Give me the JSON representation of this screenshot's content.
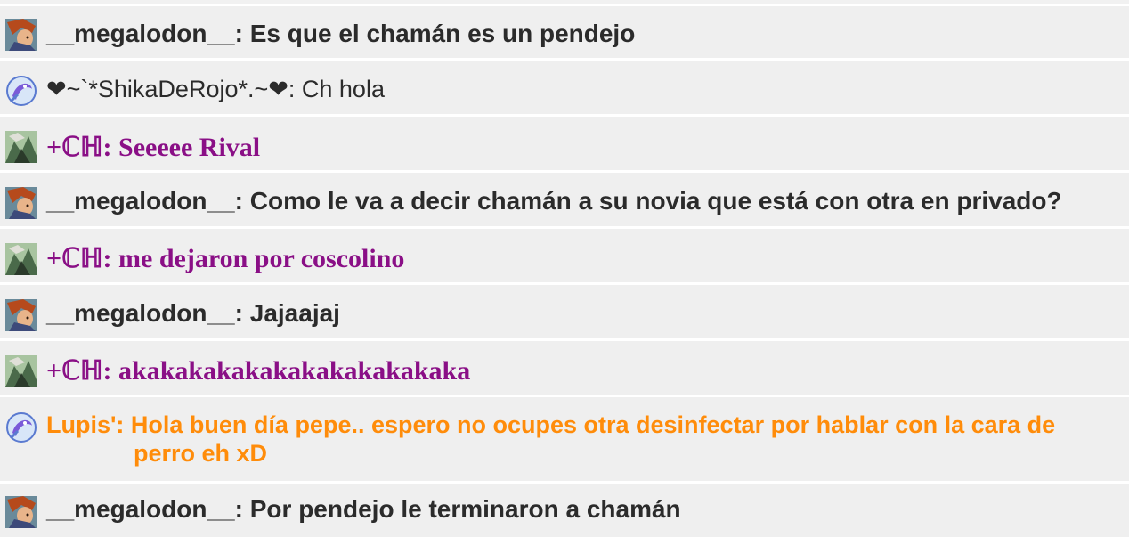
{
  "colors": {
    "default_text": "#2b2b2b",
    "ch_purple": "#8a0f86",
    "lupis_orange": "#ff8c0a",
    "row_bg": "#efefef"
  },
  "messages": [
    {
      "user": "__megalodon__",
      "sep": ": ",
      "text": "Es que el chamán es un pendejo",
      "avatar": "warrior-avatar-icon"
    },
    {
      "user": "❤~`*ShikaDeRojo*.~❤",
      "sep": ": ",
      "text": "Ch hola",
      "avatar": "bird-swirl-icon"
    },
    {
      "user": "+ℂℍ",
      "sep": ": ",
      "text": "Seeeee Rival",
      "avatar": "landscape-avatar-icon"
    },
    {
      "user": "__megalodon__",
      "sep": ": ",
      "text": "Como le va a decir chamán a su novia que está con otra en privado?",
      "avatar": "warrior-avatar-icon"
    },
    {
      "user": "+ℂℍ",
      "sep": ": ",
      "text": "me dejaron por coscolino",
      "avatar": "landscape-avatar-icon"
    },
    {
      "user": "__megalodon__",
      "sep": ": ",
      "text": "Jajaajaj",
      "avatar": "warrior-avatar-icon"
    },
    {
      "user": "+ℂℍ",
      "sep": ": ",
      "text": "akakakakakakakakakakakaka",
      "avatar": "landscape-avatar-icon"
    },
    {
      "user": "Lupis'",
      "sep": ": ",
      "text": "Hola buen día pepe.. espero no ocupes otra desinfectar por hablar con la cara de perro eh xD",
      "avatar": "bird-swirl-icon"
    },
    {
      "user": "__megalodon__",
      "sep": ": ",
      "text": "Por pendejo le terminaron a chamán",
      "avatar": "warrior-avatar-icon"
    }
  ]
}
